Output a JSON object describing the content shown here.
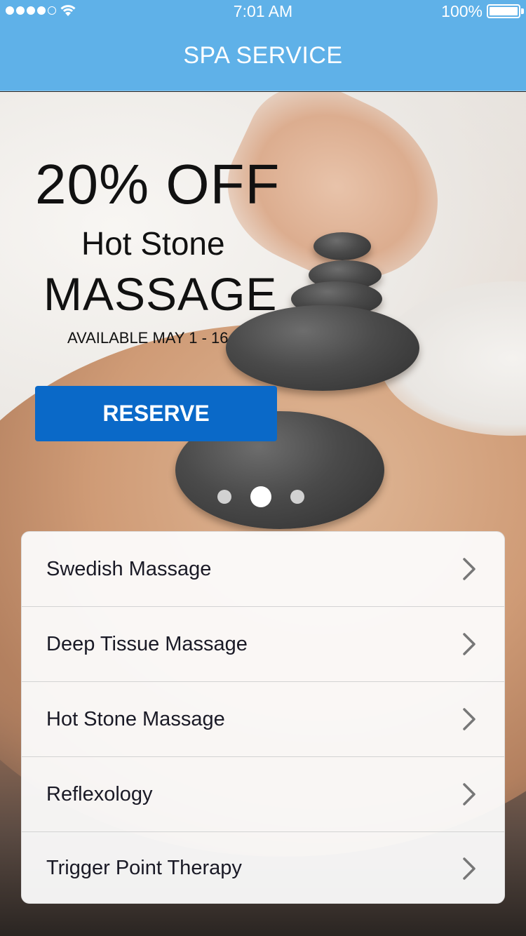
{
  "status_bar": {
    "time": "7:01 AM",
    "battery": "100%",
    "signal_icon": "signal-dots-icon",
    "wifi_icon": "wifi-icon",
    "battery_icon": "battery-icon"
  },
  "header": {
    "title": "SPA SERVICE",
    "background_color": "#5fb1e8"
  },
  "promo": {
    "discount": "20% OFF",
    "subtitle": "Hot Stone",
    "title": "MASSAGE",
    "availability": "AVAILABLE MAY 1 - 16",
    "reserve_label": "RESERVE",
    "reserve_color": "#0a69c8"
  },
  "carousel": {
    "page_count": 3,
    "active_page": 2
  },
  "services": [
    {
      "label": "Swedish Massage",
      "icon": "chevron-right-icon"
    },
    {
      "label": "Deep Tissue Massage",
      "icon": "chevron-right-icon"
    },
    {
      "label": "Hot Stone Massage",
      "icon": "chevron-right-icon"
    },
    {
      "label": "Reflexology",
      "icon": "chevron-right-icon"
    },
    {
      "label": "Trigger Point Therapy",
      "icon": "chevron-right-icon"
    }
  ]
}
